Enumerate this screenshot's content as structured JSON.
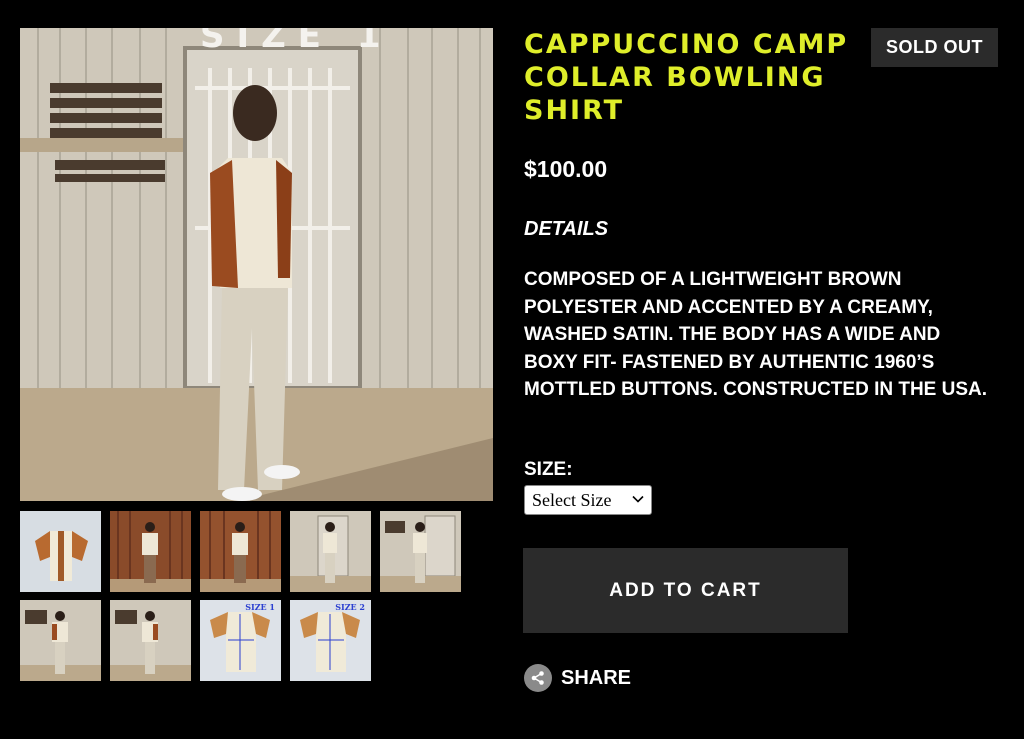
{
  "product": {
    "title": "CAPPUCCINO CAMP COLLAR BOWLING SHIRT",
    "status_badge": "SOLD OUT",
    "price": "$100.00",
    "details_heading": "DETAILS",
    "description": "COMPOSED OF A LIGHTWEIGHT BROWN POLYESTER AND ACCENTED BY A CREAMY, WASHED SATIN. THE BODY HAS A WIDE AND BOXY FIT- FASTENED BY AUTHENTIC 1960’S MOTTLED BUTTONS. CONSTRUCTED IN THE USA."
  },
  "main_image": {
    "overlay_text": "SIZE 1"
  },
  "thumbnails": [
    {
      "label": ""
    },
    {
      "label": ""
    },
    {
      "label": ""
    },
    {
      "label": ""
    },
    {
      "label": ""
    },
    {
      "label": ""
    },
    {
      "label": ""
    },
    {
      "label": "SIZE 1"
    },
    {
      "label": "SIZE 2"
    }
  ],
  "size": {
    "label": "SIZE:",
    "selected": "Select Size"
  },
  "actions": {
    "add_to_cart": "ADD TO CART",
    "share": "SHARE"
  },
  "colors": {
    "background": "#000000",
    "title": "#dfee2a",
    "button": "#2b2b2b",
    "badge": "#2b2b2b"
  },
  "icons": {
    "share": "share-icon",
    "select": "chevron-down-icon"
  }
}
